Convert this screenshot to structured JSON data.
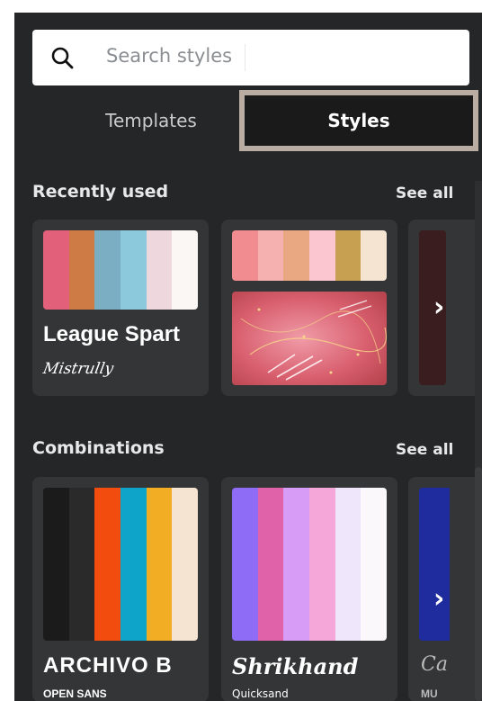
{
  "search": {
    "placeholder": "Search styles",
    "icon": "search-icon"
  },
  "tabs": [
    {
      "label": "Templates",
      "active": false
    },
    {
      "label": "Styles",
      "active": true
    }
  ],
  "recently_used": {
    "title": "Recently used",
    "see_all": "See all",
    "cards": [
      {
        "heading": "League Spart",
        "subheading": "Mistrully",
        "palette": [
          "#e2607a",
          "#cf7b45",
          "#7caec3",
          "#8cc9dd",
          "#efd8dd",
          "#fbf7f4"
        ]
      },
      {
        "palette": [
          "#f18d91",
          "#f5b0b0",
          "#e9a882",
          "#fbc6cf",
          "#c7a052",
          "#f6e4d3"
        ]
      }
    ]
  },
  "combinations": {
    "title": "Combinations",
    "see_all": "See all",
    "cards": [
      {
        "heading": "ARCHIVO B",
        "subheading": "OPEN SANS",
        "palette": [
          "#1b1b1b",
          "#2a2a2a",
          "#f24c0f",
          "#0ea4c9",
          "#f2ad24",
          "#f6e4d3"
        ]
      },
      {
        "heading": "Shrikhand",
        "subheading": "Quicksand",
        "palette": [
          "#8e6cf5",
          "#e062a8",
          "#d79cf5",
          "#f6a7d9",
          "#f0e6fb",
          "#fbf8fb"
        ]
      },
      {
        "heading": "Ca",
        "subheading": "MU",
        "palette": [
          "#1f2c9e"
        ]
      }
    ]
  },
  "colors": {
    "panel": "#252627",
    "card": "#343536",
    "active_tab": "#1a1a1a",
    "tab_outline": "#b9ada3"
  }
}
